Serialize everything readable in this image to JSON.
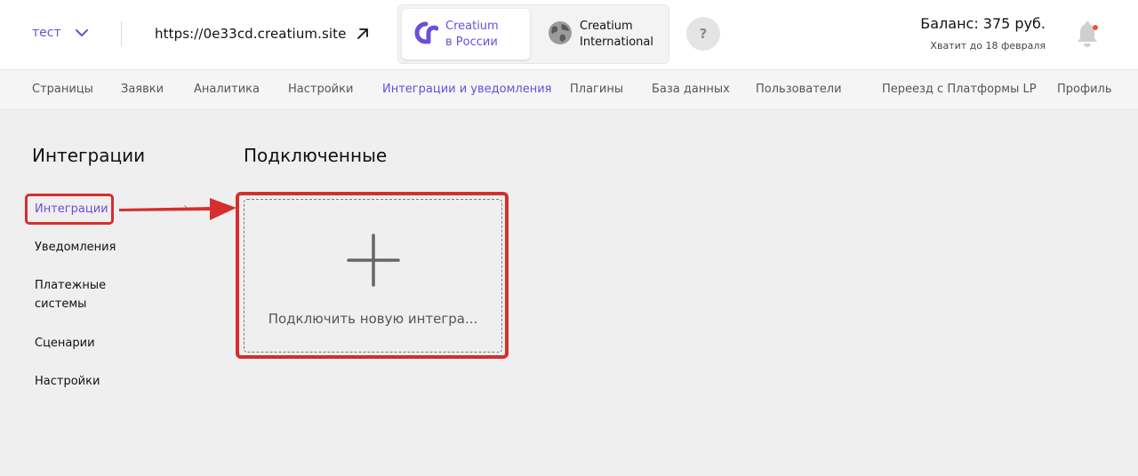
{
  "header": {
    "site_name": "тест",
    "site_url": "https://0e33cd.creatium.site",
    "regions": [
      {
        "label_line1": "Creatium",
        "label_line2": "в России",
        "active": true
      },
      {
        "label_line1": "Creatium",
        "label_line2": "International",
        "active": false
      }
    ],
    "help_label": "?",
    "balance": "Баланс: 375 руб.",
    "balance_until": "Хватит до 18 февраля"
  },
  "nav": {
    "items": [
      "Страницы",
      "Заявки",
      "Аналитика",
      "Настройки",
      "Интеграции и уведомления",
      "Плагины",
      "База данных",
      "Пользователи",
      "Переезд с Платформы LP",
      "Профиль"
    ],
    "active_index": 4
  },
  "sidebar": {
    "title": "Интеграции",
    "items": [
      {
        "label": "Интеграции"
      },
      {
        "label": "Уведомления"
      },
      {
        "label": "Платежные",
        "label2": "системы"
      },
      {
        "label": "Сценарии"
      },
      {
        "label": "Настройки"
      }
    ]
  },
  "main": {
    "title": "Подключенные",
    "add_card_label": "Подключить новую интегра..."
  },
  "colors": {
    "accent": "#6b4fd8",
    "highlight": "#d62e2e",
    "notification_dot": "#e8553e"
  }
}
